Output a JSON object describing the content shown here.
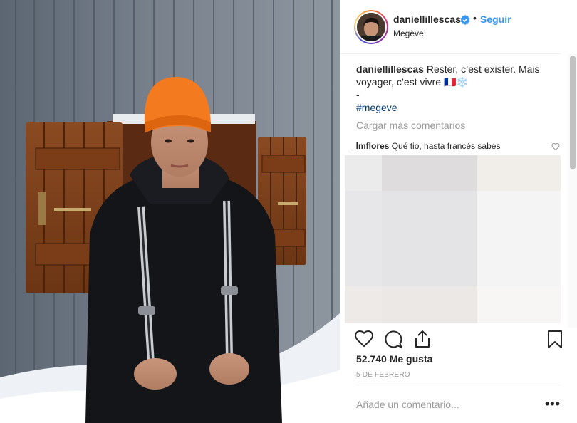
{
  "post": {
    "username": "daniellillescas",
    "follow_label": "Seguir",
    "separator": "•",
    "location": "Megève",
    "verified_icon": "verified-badge-icon",
    "caption": {
      "username": "daniellillescas",
      "line1": "Rester, c’est exister. Mais",
      "line2": "voyager, c’est vivre 🇫🇷❄️",
      "line3": "-",
      "hashtag": "#megeve"
    },
    "load_more_label": "Cargar más comentarios",
    "comment": {
      "username": "_lmflores",
      "text": "Qué tio, hasta francés sabes"
    },
    "likes_text": "52.740 Me gusta",
    "date_text": "5 DE FEBRERO",
    "add_comment_placeholder": "Añade un comentario...",
    "more_label": "•••",
    "icons": [
      "heart-icon",
      "comment-icon",
      "share-icon",
      "bookmark-icon",
      "more-options-icon"
    ],
    "colors": {
      "link": "#3897f0",
      "hashtag": "#003569",
      "muted": "#999999",
      "text": "#262626",
      "beanie": "#f47a1f"
    }
  }
}
